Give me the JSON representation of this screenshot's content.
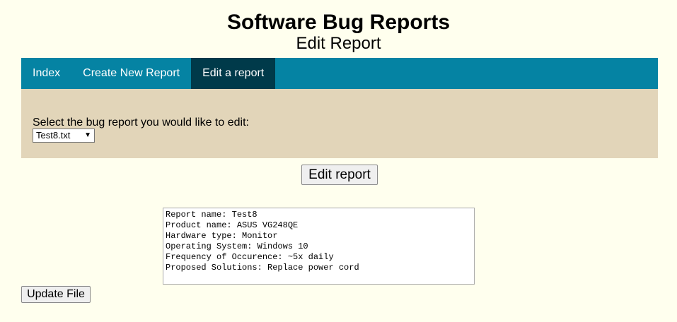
{
  "header": {
    "title": "Software Bug Reports",
    "subtitle": "Edit Report"
  },
  "nav": {
    "items": [
      {
        "label": "Index"
      },
      {
        "label": "Create New Report"
      },
      {
        "label": "Edit a report",
        "active": true
      }
    ]
  },
  "panel": {
    "label": "Select the bug report you would like to edit:",
    "select_value": "Test8.txt"
  },
  "buttons": {
    "edit_label": "Edit report",
    "update_label": "Update File"
  },
  "report": {
    "content": "Report name: Test8\nProduct name: ASUS VG248QE\nHardware type: Monitor\nOperating System: Windows 10\nFrequency of Occurence: ~5x daily\nProposed Solutions: Replace power cord"
  },
  "colors": {
    "background": "#ffffee",
    "nav": "#0583a3",
    "nav_active": "#003a4a",
    "panel": "#e2d5b9"
  }
}
